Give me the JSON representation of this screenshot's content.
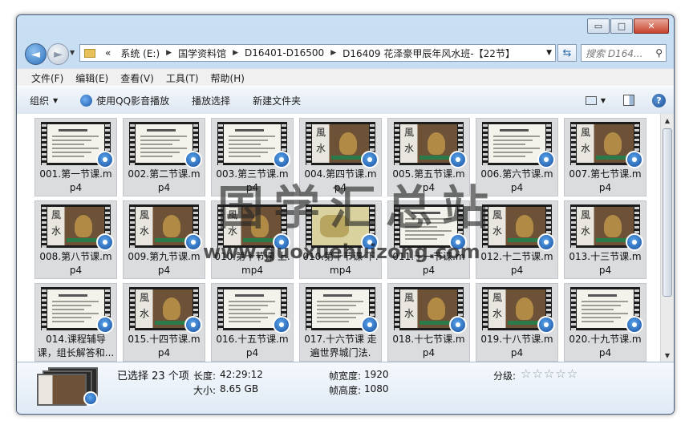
{
  "window": {
    "caption_minimize": "▭",
    "caption_maximize": "□",
    "caption_close": "✕"
  },
  "address": {
    "nav_back": "◄",
    "nav_forward": "►",
    "overflow": "«",
    "crumbs": [
      "系统 (E:)",
      "国学资料馆",
      "D16401-D16500",
      "D16409 花泽豪甲辰年风水班-【22节】"
    ],
    "search_placeholder": "搜索 D164..."
  },
  "menu": [
    "文件(F)",
    "编辑(E)",
    "查看(V)",
    "工具(T)",
    "帮助(H)"
  ],
  "toolbar": {
    "organize": "组织",
    "play_qq": "使用QQ影音播放",
    "play_selected": "播放选择",
    "new_folder": "新建文件夹",
    "help": "?"
  },
  "files": [
    {
      "name": "001.第一节课.mp4",
      "thumb": "slide"
    },
    {
      "name": "002.第二节课.mp4",
      "thumb": "slide"
    },
    {
      "name": "003.第三节课.mp4",
      "thumb": "slide"
    },
    {
      "name": "004.第四节课.mp4",
      "thumb": "fengshui"
    },
    {
      "name": "005.第五节课.mp4",
      "thumb": "fengshui"
    },
    {
      "name": "006.第六节课.mp4",
      "thumb": "slide"
    },
    {
      "name": "007.第七节课.mp4",
      "thumb": "fengshui"
    },
    {
      "name": "008.第八节课.mp4",
      "thumb": "fengshui"
    },
    {
      "name": "009.第九节课.mp4",
      "thumb": "fengshui"
    },
    {
      "name": "010.第十节课 上.mp4",
      "thumb": "fengshui"
    },
    {
      "name": "010.第十节课 下.mp4",
      "thumb": "map"
    },
    {
      "name": "011.十一节课.mp4",
      "thumb": "slide"
    },
    {
      "name": "012.十二节课.mp4",
      "thumb": "fengshui"
    },
    {
      "name": "013.十三节课.mp4",
      "thumb": "fengshui"
    },
    {
      "name": "014.课程辅导课，组长解答和...",
      "thumb": "slide"
    },
    {
      "name": "015.十四节课.mp4",
      "thumb": "fengshui"
    },
    {
      "name": "016.十五节课.mp4",
      "thumb": "slide"
    },
    {
      "name": "017.十六节课 走遍世界城门法.",
      "thumb": "slide"
    },
    {
      "name": "018.十七节课.mp4",
      "thumb": "fengshui"
    },
    {
      "name": "019.十八节课.mp4",
      "thumb": "fengshui"
    },
    {
      "name": "020.十九节课.mp4",
      "thumb": "slide"
    }
  ],
  "watermark": {
    "big": "国学汇总站",
    "url": "www.guoxuehuizong.com"
  },
  "details": {
    "selected": "已选择 23 个项",
    "length_label": "长度:",
    "length_value": "42:29:12",
    "size_label": "大小:",
    "size_value": "8.65 GB",
    "frame_width_label": "帧宽度:",
    "frame_width_value": "1920",
    "frame_height_label": "帧高度:",
    "frame_height_value": "1080",
    "rating_label": "分级:",
    "rating_stars": "☆☆☆☆☆"
  },
  "scrollbar": {
    "up": "▲",
    "down": "▼"
  }
}
